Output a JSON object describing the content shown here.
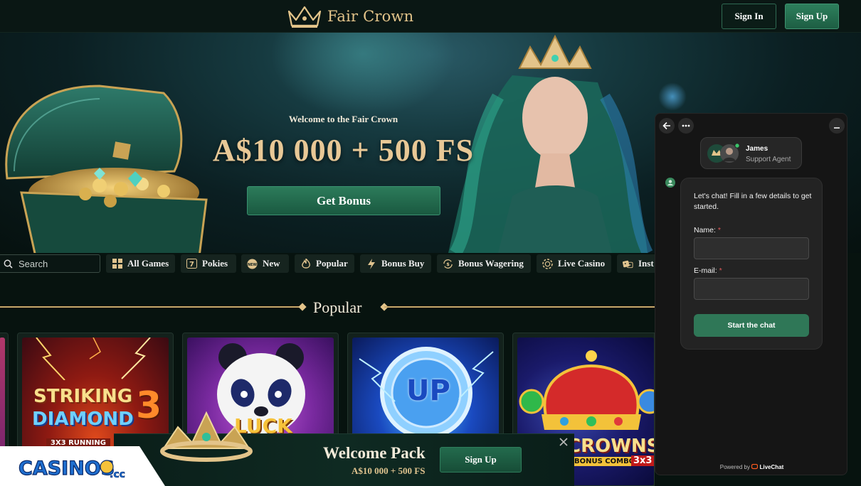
{
  "header": {
    "logo_text": "Fair Crown",
    "sign_in": "Sign In",
    "sign_up": "Sign Up"
  },
  "hero": {
    "kicker": "Welcome to the Fair Crown",
    "amount": "A$10 000 + 500 FS",
    "cta": "Get Bonus"
  },
  "search": {
    "placeholder": "Search"
  },
  "categories": [
    {
      "label": "All Games",
      "icon": "grid-icon"
    },
    {
      "label": "Pokies",
      "icon": "slot-icon"
    },
    {
      "label": "New",
      "icon": "new-badge-icon"
    },
    {
      "label": "Popular",
      "icon": "flame-icon"
    },
    {
      "label": "Bonus Buy",
      "icon": "lightning-icon"
    },
    {
      "label": "Bonus Wagering",
      "icon": "coin-cycle-icon"
    },
    {
      "label": "Live Casino",
      "icon": "chip-icon"
    },
    {
      "label": "Inst",
      "icon": "dice-icon"
    }
  ],
  "section": {
    "title": "Popular"
  },
  "games": [
    {
      "title_line1": "STRIKING",
      "title_line2": "DIAMOND",
      "title_num": "3",
      "badge": "3X3 RUNNING"
    },
    {
      "title_line1": "LUCK"
    },
    {
      "title_line1": "UP"
    },
    {
      "title_line1": "CROWNS",
      "badge": "BONUS COMBO",
      "badge2": "3x3"
    }
  ],
  "chat": {
    "agent_name": "James",
    "agent_role": "Support Agent",
    "message": "Let's chat! Fill in a few details to get started.",
    "name_label": "Name:",
    "email_label": "E-mail:",
    "required_mark": "*",
    "start_button": "Start the chat",
    "powered_prefix": "Powered by",
    "powered_brand": "LiveChat"
  },
  "promo": {
    "title": "Welcome Pack",
    "subtitle": "A$10 000 + 500 FS",
    "cta": "Sign Up"
  },
  "badge": {
    "text": "CASINOS",
    "suffix": ".cc"
  },
  "colors": {
    "accent_gold": "#e3c48a",
    "accent_green": "#2d7f5c",
    "background": "#07130f"
  }
}
